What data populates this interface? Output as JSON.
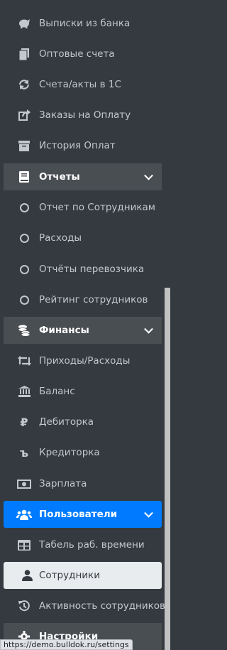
{
  "sidebar": {
    "items": [
      {
        "label": "Выписки из банка",
        "icon": "piggy-bank-icon"
      },
      {
        "label": "Оптовые счета",
        "icon": "copy-icon"
      },
      {
        "label": "Счета/акты в 1С",
        "icon": "sync-icon"
      },
      {
        "label": "Заказы на Оплату",
        "icon": "share-square-icon"
      },
      {
        "label": "История Оплат",
        "icon": "archive-icon"
      },
      {
        "label": "Отчеты",
        "icon": "book-icon"
      },
      {
        "label": "Отчет по Сотрудникам",
        "icon": "circle-icon"
      },
      {
        "label": "Расходы",
        "icon": "circle-icon"
      },
      {
        "label": "Отчёты перевозчика",
        "icon": "circle-icon"
      },
      {
        "label": "Рейтинг сотрудников",
        "icon": "circle-icon"
      },
      {
        "label": "Финансы",
        "icon": "coins-icon"
      },
      {
        "label": "Приходы/Расходы",
        "icon": "retweet-icon"
      },
      {
        "label": "Баланс",
        "icon": "bank-icon"
      },
      {
        "label": "Дебиторка",
        "icon": "ruble-icon"
      },
      {
        "label": "Кредиторка",
        "icon": "bitcoin-b-icon"
      },
      {
        "label": "Зарплата",
        "icon": "money-bill-icon"
      },
      {
        "label": "Пользователи",
        "icon": "users-icon"
      },
      {
        "label": "Табель раб. времени",
        "icon": "table-icon"
      },
      {
        "label": "Сотрудники",
        "icon": "user-icon"
      },
      {
        "label": "Активность сотрудников",
        "icon": "history-icon"
      },
      {
        "label": "Настройки",
        "icon": "gear-icon"
      }
    ]
  },
  "statusbar": {
    "url": "https://demo.bulldok.ru/settings"
  },
  "colors": {
    "sidebar_bg": "#343a40",
    "active_blue": "#007bff",
    "active_light": "#e9ecef",
    "open_bg": "#494e53"
  }
}
